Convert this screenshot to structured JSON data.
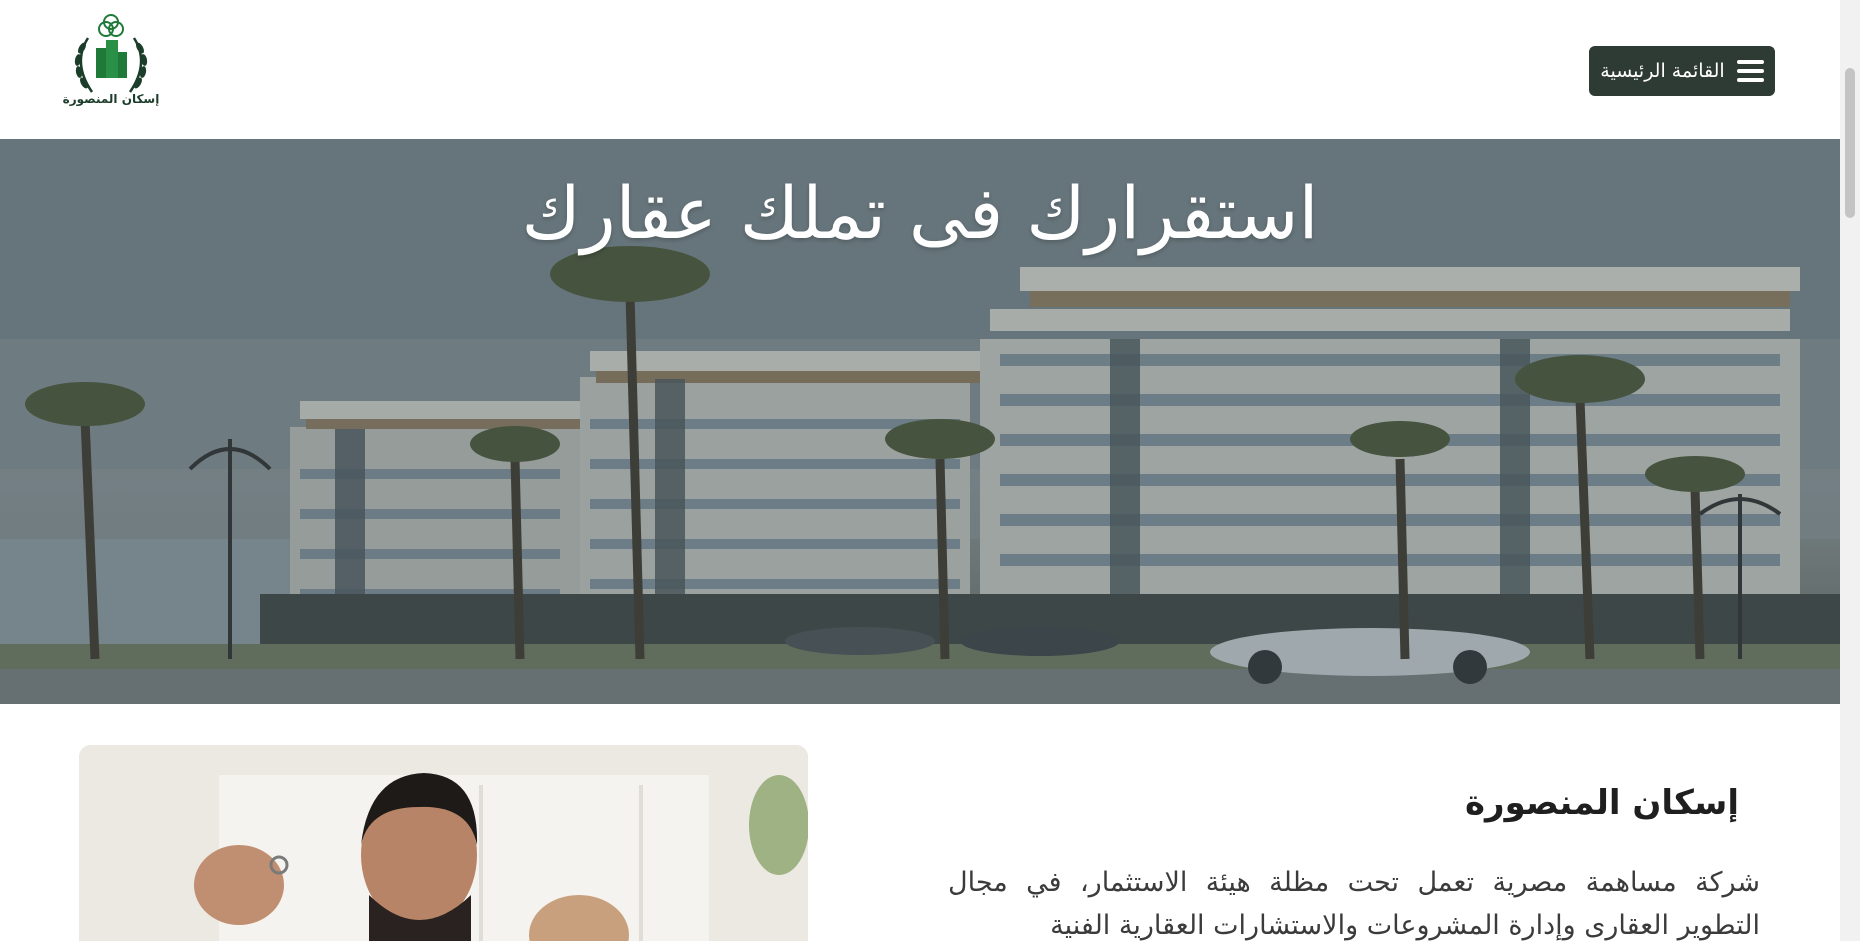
{
  "header": {
    "logo_text": "إسكان المنصورة",
    "menu_label": "القائمة الرئيسية",
    "menu_icon": "hamburger-menu-icon"
  },
  "hero": {
    "title": "استقرارك فى تملك عقارك"
  },
  "about": {
    "title": "إسكان المنصورة",
    "text": "شركة مساهمة مصرية تعمل تحت مظلة هيئة الاستثمار، في مجال التطوير العقارى وإدارة المشروعات والاستشارات العقارية الفنية"
  },
  "colors": {
    "menu_button_bg": "#2e3a34",
    "logo_green": "#1f7a3a"
  }
}
